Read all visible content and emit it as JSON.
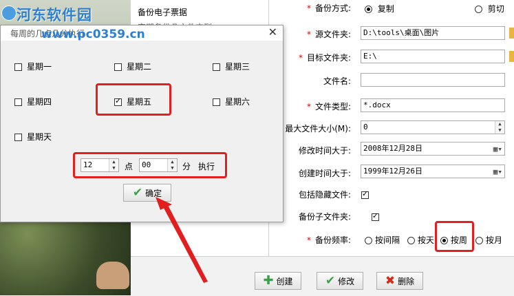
{
  "watermark": {
    "site_name": "河东软件园",
    "url": "www.pc0359.cn"
  },
  "list": {
    "item1": "备份电子票据",
    "item2": "定期备份几文件夹到..."
  },
  "form": {
    "backup_mode_label": "备份方式:",
    "copy_label": "复制",
    "cut_label": "剪切",
    "source_label": "源文件夹:",
    "source_value": "D:\\tools\\桌面\\图片",
    "target_label": "目标文件夹:",
    "target_value": "E:\\",
    "filename_label": "文件名:",
    "filename_value": "",
    "filetype_label": "文件类型:",
    "filetype_value": "*.docx",
    "maxsize_label": "最大文件大小(M):",
    "maxsize_value": "0",
    "modified_label": "修改时间大于:",
    "modified_value": "2008年12月28日",
    "created_label": "创建时间大于:",
    "created_value": "1999年12月26日",
    "hidden_label": "包括隐藏文件:",
    "subfolder_label": "备份子文件夹:",
    "frequency_label": "备份频率:",
    "freq_interval": "按间隔",
    "freq_day": "按天",
    "freq_week": "按周",
    "freq_month": "按月"
  },
  "buttons": {
    "create": "创建",
    "modify": "修改",
    "delete": "删除"
  },
  "dialog": {
    "title": "每周的几点几分执行",
    "days": [
      "星期一",
      "星期二",
      "星期三",
      "星期四",
      "星期五",
      "星期六",
      "星期天"
    ],
    "checked_day": "星期五",
    "hour_value": "12",
    "hour_unit": "点",
    "minute_value": "00",
    "minute_unit": "分",
    "execute_label": "执行",
    "confirm_label": "确定",
    "close_icon": "✕"
  },
  "colors": {
    "highlight": "#e21f1f",
    "accent_green": "#3aa14a",
    "required_star": "#d20000"
  }
}
